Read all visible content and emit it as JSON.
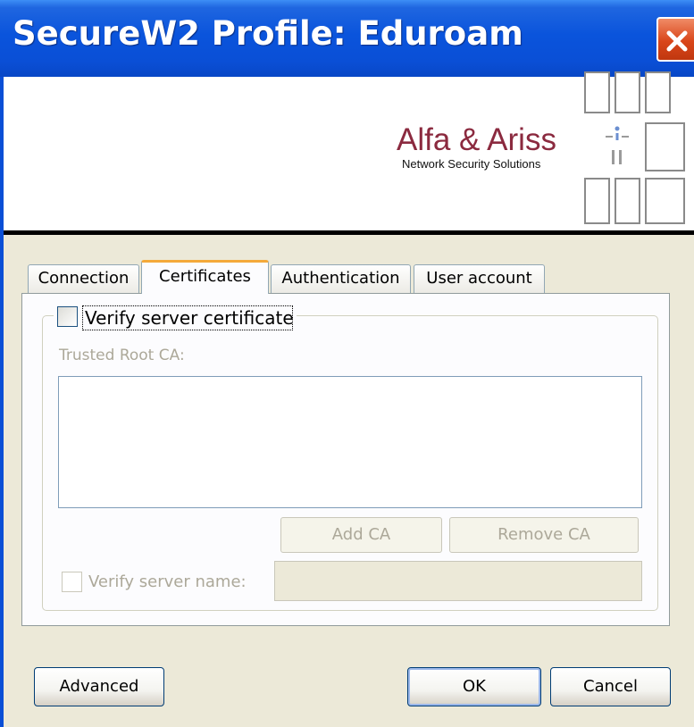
{
  "window": {
    "title": "SecureW2 Profile: Eduroam"
  },
  "banner": {
    "logo_name": "Alfa & Ariss",
    "logo_tagline": "Network Security Solutions"
  },
  "tabs": [
    {
      "label": "Connection",
      "active": false
    },
    {
      "label": "Certificates",
      "active": true
    },
    {
      "label": "Authentication",
      "active": false
    },
    {
      "label": "User account",
      "active": false
    }
  ],
  "certificates": {
    "verify_server_certificate": {
      "label": "Verify server certificate",
      "checked": false
    },
    "trusted_root_ca_label": "Trusted Root CA:",
    "trusted_root_ca_items": [],
    "add_ca_label": "Add CA",
    "remove_ca_label": "Remove CA",
    "verify_server_name": {
      "label": "Verify server name:",
      "checked": false,
      "value": ""
    }
  },
  "footer": {
    "advanced_label": "Advanced",
    "ok_label": "OK",
    "cancel_label": "Cancel"
  },
  "colors": {
    "titlebar": "#0a54dc",
    "logo_text": "#8b2a3f",
    "active_tab_accent": "#f4a93a",
    "close_button": "#d9461a"
  }
}
